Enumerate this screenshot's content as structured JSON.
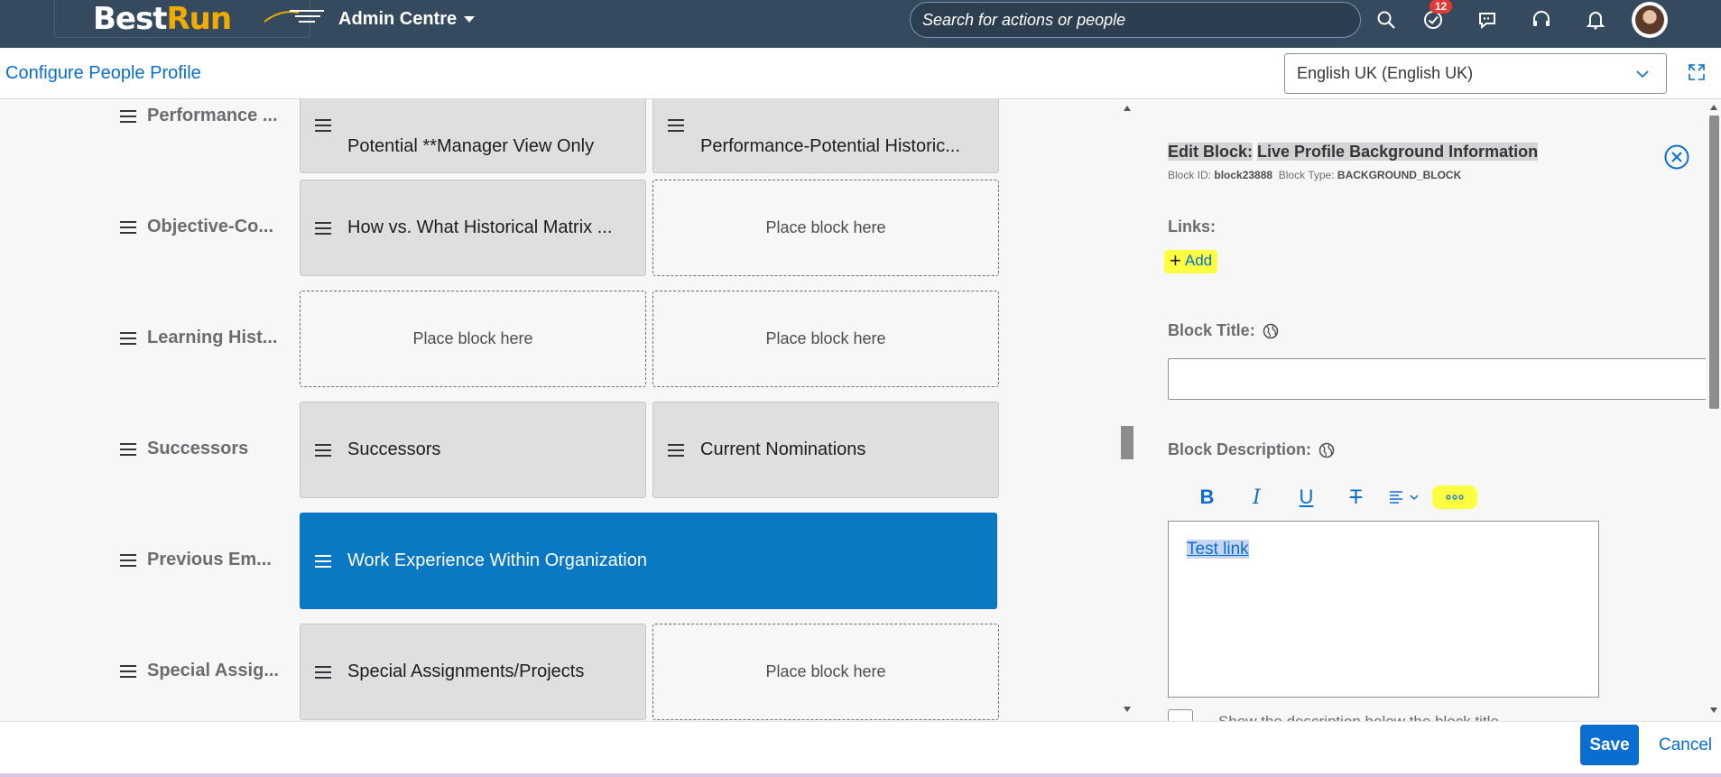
{
  "shell": {
    "logo_best": "Best",
    "logo_run": "Run",
    "app_menu": "Admin Centre",
    "search_placeholder": "Search for actions or people",
    "notification_count": "12"
  },
  "subheader": {
    "title": "Configure People Profile",
    "language": "English UK (English UK)"
  },
  "rows": [
    {
      "label": "Performance ...",
      "blocks": [
        {
          "type": "filled",
          "label": "Potential **Manager View Only"
        },
        {
          "type": "filled",
          "label": "Performance-Potential Historic..."
        }
      ]
    },
    {
      "label": "Objective-Co...",
      "blocks": [
        {
          "type": "filled",
          "label": "How vs. What Historical Matrix ..."
        },
        {
          "type": "empty",
          "label": "Place block here"
        }
      ]
    },
    {
      "label": "Learning Hist...",
      "blocks": [
        {
          "type": "empty",
          "label": "Place block here"
        },
        {
          "type": "empty",
          "label": "Place block here"
        }
      ]
    },
    {
      "label": "Successors",
      "blocks": [
        {
          "type": "filled",
          "label": "Successors"
        },
        {
          "type": "filled",
          "label": "Current Nominations"
        }
      ]
    },
    {
      "label": "Previous Em...",
      "blocks": [
        {
          "type": "selected",
          "label": "Work Experience Within Organization"
        }
      ]
    },
    {
      "label": "Special Assig...",
      "blocks": [
        {
          "type": "filled",
          "label": "Special Assignments/Projects"
        },
        {
          "type": "empty",
          "label": "Place block here"
        }
      ]
    }
  ],
  "panel": {
    "edit_prefix": "Edit Block:",
    "block_name": "Live Profile Background Information",
    "block_id_label": "Block ID:",
    "block_id": "block23888",
    "block_type_label": "Block Type:",
    "block_type": "BACKGROUND_BLOCK",
    "links_label": "Links:",
    "add_label": "Add",
    "block_title_label": "Block Title:",
    "block_title_value": "",
    "block_description_label": "Block Description:",
    "toolbar": {
      "bold": "B",
      "italic": "I",
      "underline": "U",
      "strike": "T"
    },
    "description_link": "Test link",
    "show_description_label": "Show the description below the block title"
  },
  "footer": {
    "save": "Save",
    "cancel": "Cancel"
  },
  "colors": {
    "shell_bg": "#354a5f",
    "accent": "#0a6ed1",
    "selected_block": "#0a78c2",
    "highlight": "#fcff40",
    "badge": "#e53935"
  }
}
